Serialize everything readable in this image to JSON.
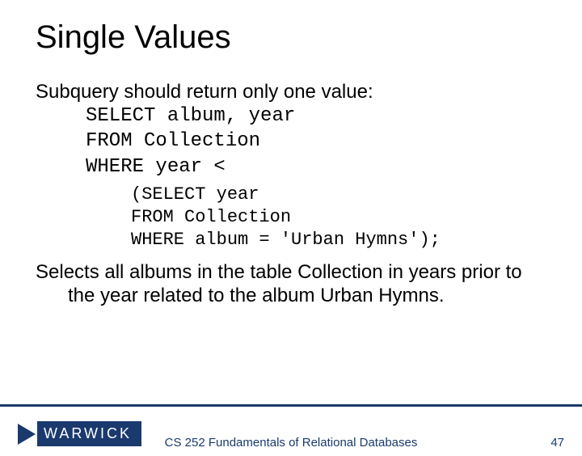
{
  "title": "Single Values",
  "intro": "Subquery should return only one value:",
  "code": {
    "l1": "SELECT album, year",
    "l2": "FROM Collection",
    "l3a": "WHERE year ",
    "l3b": "<"
  },
  "subcode": {
    "l1": "(SELECT year",
    "l2": "FROM Collection",
    "l3": "WHERE album = 'Urban Hymns');"
  },
  "explain": "Selects all albums in the table Collection in years prior to the year related to the album Urban Hymns.",
  "footer": {
    "logo": "WARWICK",
    "course": "CS 252 Fundamentals of Relational Databases",
    "page": "47"
  }
}
